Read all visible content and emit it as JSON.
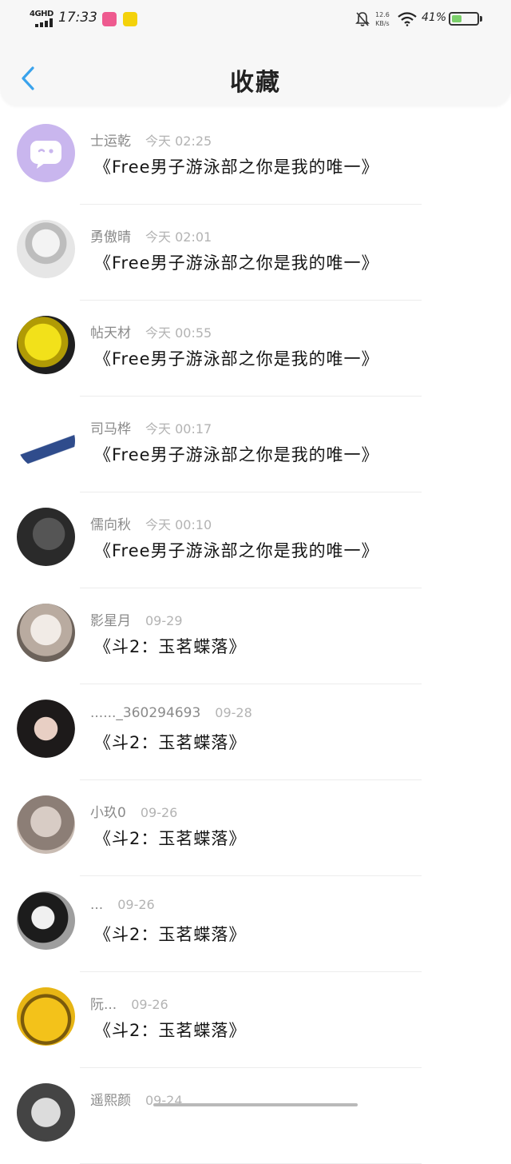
{
  "status_bar": {
    "network": "4GHD",
    "time": "17:33",
    "speed_value": "12.6",
    "speed_unit": "KB/s",
    "battery": "41%",
    "battery_level": 0.41
  },
  "header": {
    "title": "收藏"
  },
  "items": [
    {
      "name": "士运乾",
      "time": "今天 02:25",
      "title": "《Free男子游泳部之你是我的唯一》"
    },
    {
      "name": "勇傲晴",
      "time": "今天 02:01",
      "title": "《Free男子游泳部之你是我的唯一》"
    },
    {
      "name": "帖天材",
      "time": "今天 00:55",
      "title": "《Free男子游泳部之你是我的唯一》"
    },
    {
      "name": "司马桦",
      "time": "今天 00:17",
      "title": "《Free男子游泳部之你是我的唯一》"
    },
    {
      "name": "儒向秋",
      "time": "今天 00:10",
      "title": "《Free男子游泳部之你是我的唯一》"
    },
    {
      "name": "影星月",
      "time": "09-29",
      "title": "《斗2：玉茗蝶落》"
    },
    {
      "name": "......_360294693",
      "time": "09-28",
      "title": "《斗2：玉茗蝶落》"
    },
    {
      "name": "小玖0",
      "time": "09-26",
      "title": "《斗2：玉茗蝶落》"
    },
    {
      "name": "...",
      "time": "09-26",
      "title": "《斗2：玉茗蝶落》"
    },
    {
      "name": "阮...",
      "time": "09-26",
      "title": "《斗2：玉茗蝶落》"
    },
    {
      "name": "遥熙颜",
      "time": "09-24",
      "title": ""
    }
  ],
  "colors": {
    "accent": "#3aa3ec",
    "avatar_default": "#c9b6ee"
  }
}
